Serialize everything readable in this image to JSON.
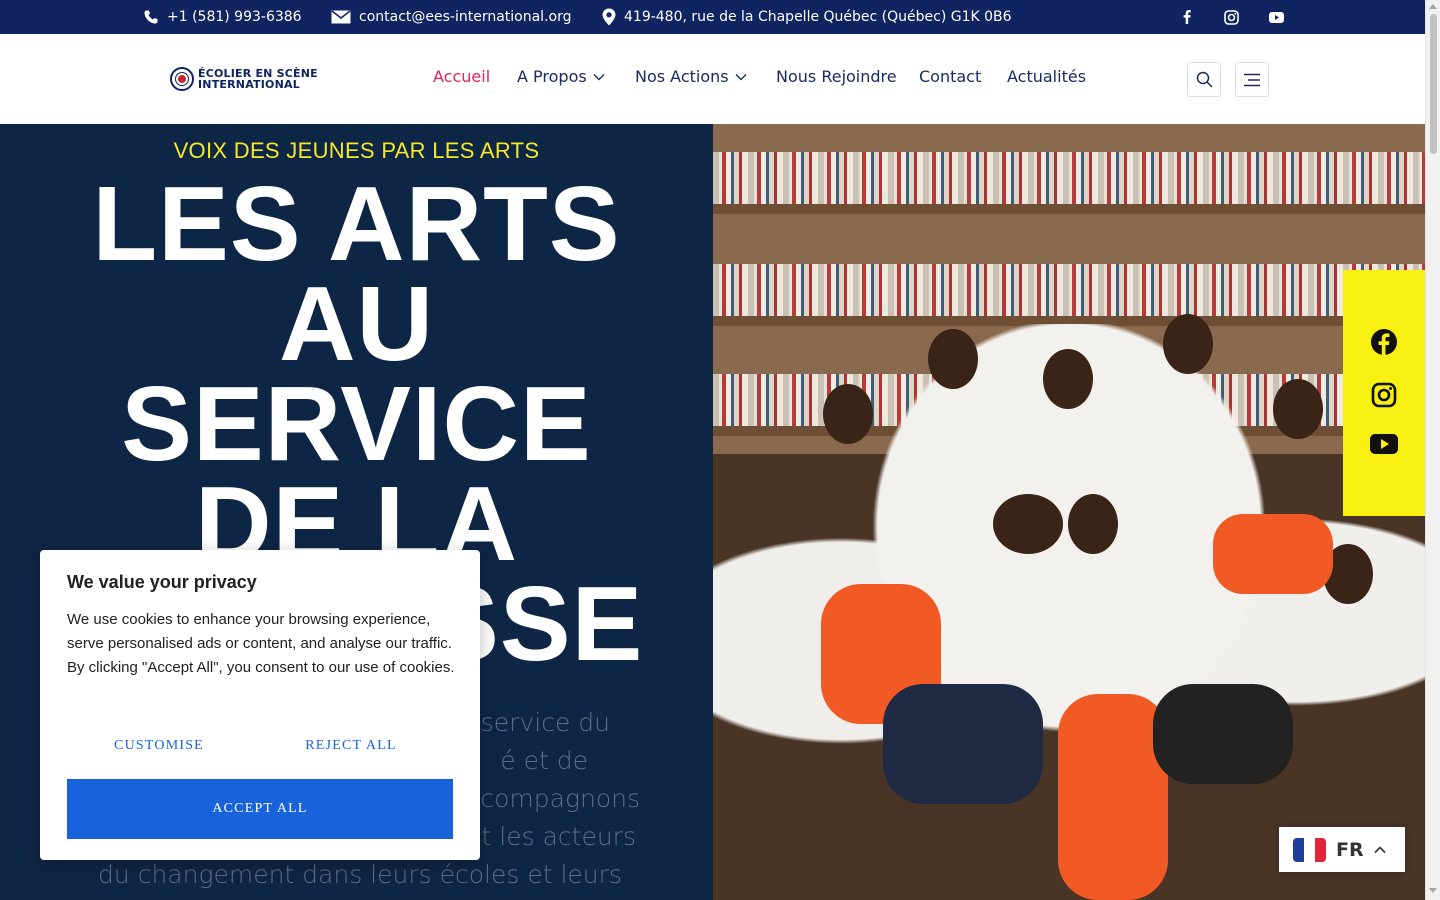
{
  "topbar": {
    "phone": "+1 (581) 993-6386",
    "email": "contact@ees-international.org",
    "address": "419-480, rue de la Chapelle Québec (Québec) G1K 0B6",
    "socials": [
      "facebook-icon",
      "instagram-icon",
      "youtube-icon"
    ],
    "bg_color": "#0f2460"
  },
  "header": {
    "logo_line1": "ÉCOLIER EN SCÈNE",
    "logo_line2": "INTERNATIONAL",
    "nav": [
      {
        "label": "Accueil",
        "active": true
      },
      {
        "label": "A Propos",
        "dropdown": true
      },
      {
        "label": "Nos Actions",
        "dropdown": true
      },
      {
        "label": "Nous Rejoindre"
      },
      {
        "label": "Contact"
      },
      {
        "label": "Actualités"
      }
    ],
    "active_color": "#e0245e"
  },
  "hero": {
    "tagline": "VOIX DES JEUNES PAR LES ARTS",
    "title_lines": [
      "LES ARTS",
      "AU",
      "SERVICE",
      "DE LA",
      "JEUNESSE"
    ],
    "paragraph_lines": [
      "service du",
      "é et de",
      "compagnons",
      "t les acteurs",
      "du changement dans leurs écoles et leurs"
    ],
    "bg_color": "#0e2645",
    "tag_color": "#f5e82a"
  },
  "floating_social": {
    "icons": [
      "facebook-icon",
      "instagram-icon",
      "youtube-icon"
    ],
    "bg_color": "#f7f012"
  },
  "cookie": {
    "title": "We value your privacy",
    "text": "We use cookies to enhance your browsing experience, serve personalised ads or content, and analyse our traffic. By clicking \"Accept All\", you consent to our use of cookies.",
    "customise": "CUSTOMISE",
    "reject": "REJECT ALL",
    "accept": "ACCEPT ALL",
    "accent": "#1863dc"
  },
  "language": {
    "code": "FR"
  }
}
